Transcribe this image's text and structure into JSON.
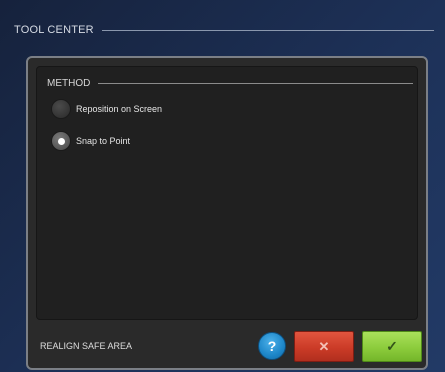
{
  "tool_center": {
    "section_title": "TOOL CENTER"
  },
  "method": {
    "section_title": "METHOD",
    "options": [
      {
        "label": "Reposition on Screen",
        "selected": false
      },
      {
        "label": "Snap to Point",
        "selected": true
      }
    ]
  },
  "footer": {
    "label": "REALIGN SAFE AREA",
    "help_glyph": "?",
    "cancel_glyph": "✕",
    "confirm_glyph": "✓"
  },
  "icons": {
    "help": "question-icon",
    "cancel": "close-icon",
    "confirm": "check-icon"
  },
  "colors": {
    "help_button": "#1d86c8",
    "cancel_button": "#cb3b27",
    "confirm_button": "#8ccc3c",
    "background": "#1d3158",
    "panel": "#2a2a2a"
  }
}
